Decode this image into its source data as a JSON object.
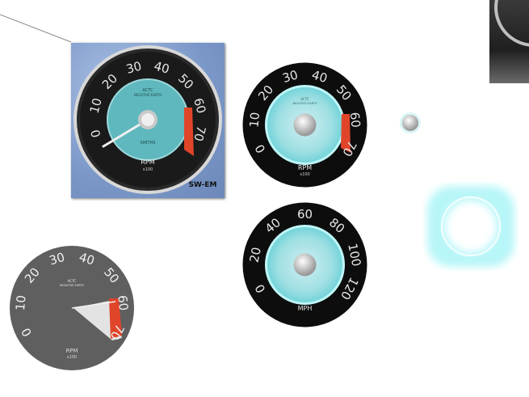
{
  "photo_gauge": {
    "numbers": [
      "0",
      "10",
      "20",
      "30",
      "40",
      "50",
      "60",
      "70"
    ],
    "unit": "RPM",
    "multiplier": "x100",
    "brand_line1": "ACTC",
    "brand_line2": "NEGATIVE EARTH",
    "label_bottom": "SMITHS",
    "watermark": "SW-EM"
  },
  "rpm_gauge": {
    "numbers": [
      "0",
      "10",
      "20",
      "30",
      "40",
      "50",
      "60",
      "70"
    ],
    "unit": "RPM",
    "multiplier": "x100",
    "brand_line1": "ACTC",
    "brand_line2": "NEGATIVE EARTH"
  },
  "mph_gauge": {
    "numbers": [
      "0",
      "20",
      "40",
      "60",
      "80",
      "100",
      "120"
    ],
    "unit": "MPH"
  },
  "gray_gauge": {
    "numbers": [
      "0",
      "10",
      "20",
      "30",
      "40",
      "50",
      "60",
      "70"
    ],
    "unit": "RPM",
    "multiplier": "x100",
    "brand_line1": "ACTC",
    "brand_line2": "NEGATIVE EARTH"
  },
  "colors": {
    "teal": "#6fd3d8",
    "glow": "#8ff2f4",
    "redzone": "#e0452a",
    "dial_black": "#0d0d0d",
    "gray_dial": "#5f5f5f"
  }
}
